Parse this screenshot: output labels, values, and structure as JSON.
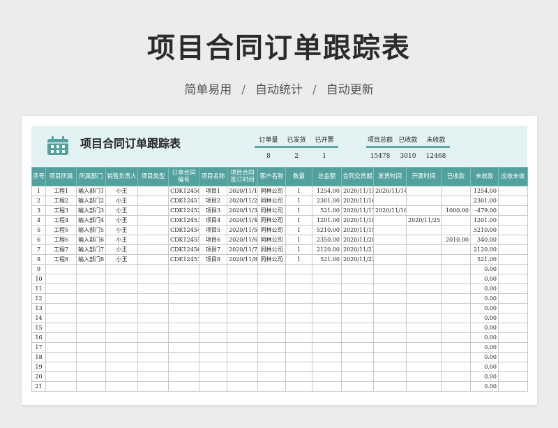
{
  "page": {
    "title": "项目合同订单跟踪表",
    "subtitle": [
      "简单易用",
      "自动统计",
      "自动更新"
    ],
    "separator": "/"
  },
  "sheet": {
    "title": "项目合同订单跟踪表",
    "stats_a": {
      "labels": [
        "订单量",
        "已发货",
        "已开票"
      ],
      "values": [
        "8",
        "2",
        "1"
      ]
    },
    "stats_b": {
      "labels": [
        "项目总额",
        "已收款",
        "未收款"
      ],
      "values": [
        "15478",
        "3010",
        "12468"
      ]
    },
    "accent_color": "#52a19c",
    "header_bg": "#e3f2f3"
  },
  "table": {
    "columns": [
      "序号",
      "项目所属",
      "所属部门",
      "销售负责人",
      "项目类型",
      "订单合同编号",
      "项目名称",
      "项目合同签订时间",
      "客户名称",
      "数量",
      "总金额",
      "合同交货期",
      "发货时间",
      "开票时间",
      "已收款",
      "未收款",
      "应收未收"
    ],
    "rows": [
      [
        "1",
        "工程1",
        "输入部门1",
        "小王",
        "",
        "CDK12450",
        "项目1",
        "2020/11/1",
        "同林公司",
        "1",
        "1254.00",
        "2020/11/15",
        "2020/11/14",
        "",
        "",
        "1254.00",
        ""
      ],
      [
        "2",
        "工程2",
        "输入部门2",
        "小王",
        "",
        "CDK12451",
        "项目2",
        "2020/11/2",
        "同林公司",
        "1",
        "2301.00",
        "2020/11/16",
        "",
        "",
        "",
        "2301.00",
        ""
      ],
      [
        "3",
        "工程3",
        "输入部门3",
        "小王",
        "",
        "CDK12452",
        "项目3",
        "2020/11/3",
        "同林公司",
        "1",
        "521.00",
        "2020/11/17",
        "2020/11/16",
        "",
        "1000.00",
        "-479.00",
        ""
      ],
      [
        "4",
        "工程4",
        "输入部门4",
        "小王",
        "",
        "CDK12453",
        "项目4",
        "2020/11/4",
        "同林公司",
        "1",
        "1201.00",
        "2020/11/18",
        "",
        "2020/11/25",
        "",
        "1201.00",
        ""
      ],
      [
        "5",
        "工程5",
        "输入部门5",
        "小王",
        "",
        "CDK12454",
        "项目5",
        "2020/11/5",
        "同林公司",
        "1",
        "5210.00",
        "2020/11/19",
        "",
        "",
        "",
        "5210.00",
        ""
      ],
      [
        "6",
        "工程6",
        "输入部门6",
        "小王",
        "",
        "CDK12455",
        "项目6",
        "2020/11/6",
        "同林公司",
        "1",
        "2350.00",
        "2020/11/20",
        "",
        "",
        "2010.00",
        "340.00",
        ""
      ],
      [
        "7",
        "工程7",
        "输入部门7",
        "小王",
        "",
        "CDK12456",
        "项目7",
        "2020/11/7",
        "同林公司",
        "1",
        "2120.00",
        "2020/11/21",
        "",
        "",
        "",
        "2120.00",
        ""
      ],
      [
        "8",
        "工程8",
        "输入部门8",
        "小王",
        "",
        "CDK12457",
        "项目8",
        "2020/11/8",
        "同林公司",
        "1",
        "521.00",
        "2020/11/22",
        "",
        "",
        "",
        "521.00",
        ""
      ],
      [
        "9",
        "",
        "",
        "",
        "",
        "",
        "",
        "",
        "",
        "",
        "",
        "",
        "",
        "",
        "",
        "0.00",
        ""
      ],
      [
        "10",
        "",
        "",
        "",
        "",
        "",
        "",
        "",
        "",
        "",
        "",
        "",
        "",
        "",
        "",
        "0.00",
        ""
      ],
      [
        "11",
        "",
        "",
        "",
        "",
        "",
        "",
        "",
        "",
        "",
        "",
        "",
        "",
        "",
        "",
        "0.00",
        ""
      ],
      [
        "12",
        "",
        "",
        "",
        "",
        "",
        "",
        "",
        "",
        "",
        "",
        "",
        "",
        "",
        "",
        "0.00",
        ""
      ],
      [
        "13",
        "",
        "",
        "",
        "",
        "",
        "",
        "",
        "",
        "",
        "",
        "",
        "",
        "",
        "",
        "0.00",
        ""
      ],
      [
        "14",
        "",
        "",
        "",
        "",
        "",
        "",
        "",
        "",
        "",
        "",
        "",
        "",
        "",
        "",
        "0.00",
        ""
      ],
      [
        "15",
        "",
        "",
        "",
        "",
        "",
        "",
        "",
        "",
        "",
        "",
        "",
        "",
        "",
        "",
        "0.00",
        ""
      ],
      [
        "16",
        "",
        "",
        "",
        "",
        "",
        "",
        "",
        "",
        "",
        "",
        "",
        "",
        "",
        "",
        "0.00",
        ""
      ],
      [
        "17",
        "",
        "",
        "",
        "",
        "",
        "",
        "",
        "",
        "",
        "",
        "",
        "",
        "",
        "",
        "0.00",
        ""
      ],
      [
        "18",
        "",
        "",
        "",
        "",
        "",
        "",
        "",
        "",
        "",
        "",
        "",
        "",
        "",
        "",
        "0.00",
        ""
      ],
      [
        "19",
        "",
        "",
        "",
        "",
        "",
        "",
        "",
        "",
        "",
        "",
        "",
        "",
        "",
        "",
        "0.00",
        ""
      ],
      [
        "20",
        "",
        "",
        "",
        "",
        "",
        "",
        "",
        "",
        "",
        "",
        "",
        "",
        "",
        "",
        "0.00",
        ""
      ],
      [
        "21",
        "",
        "",
        "",
        "",
        "",
        "",
        "",
        "",
        "",
        "",
        "",
        "",
        "",
        "",
        "0.00",
        ""
      ]
    ]
  }
}
